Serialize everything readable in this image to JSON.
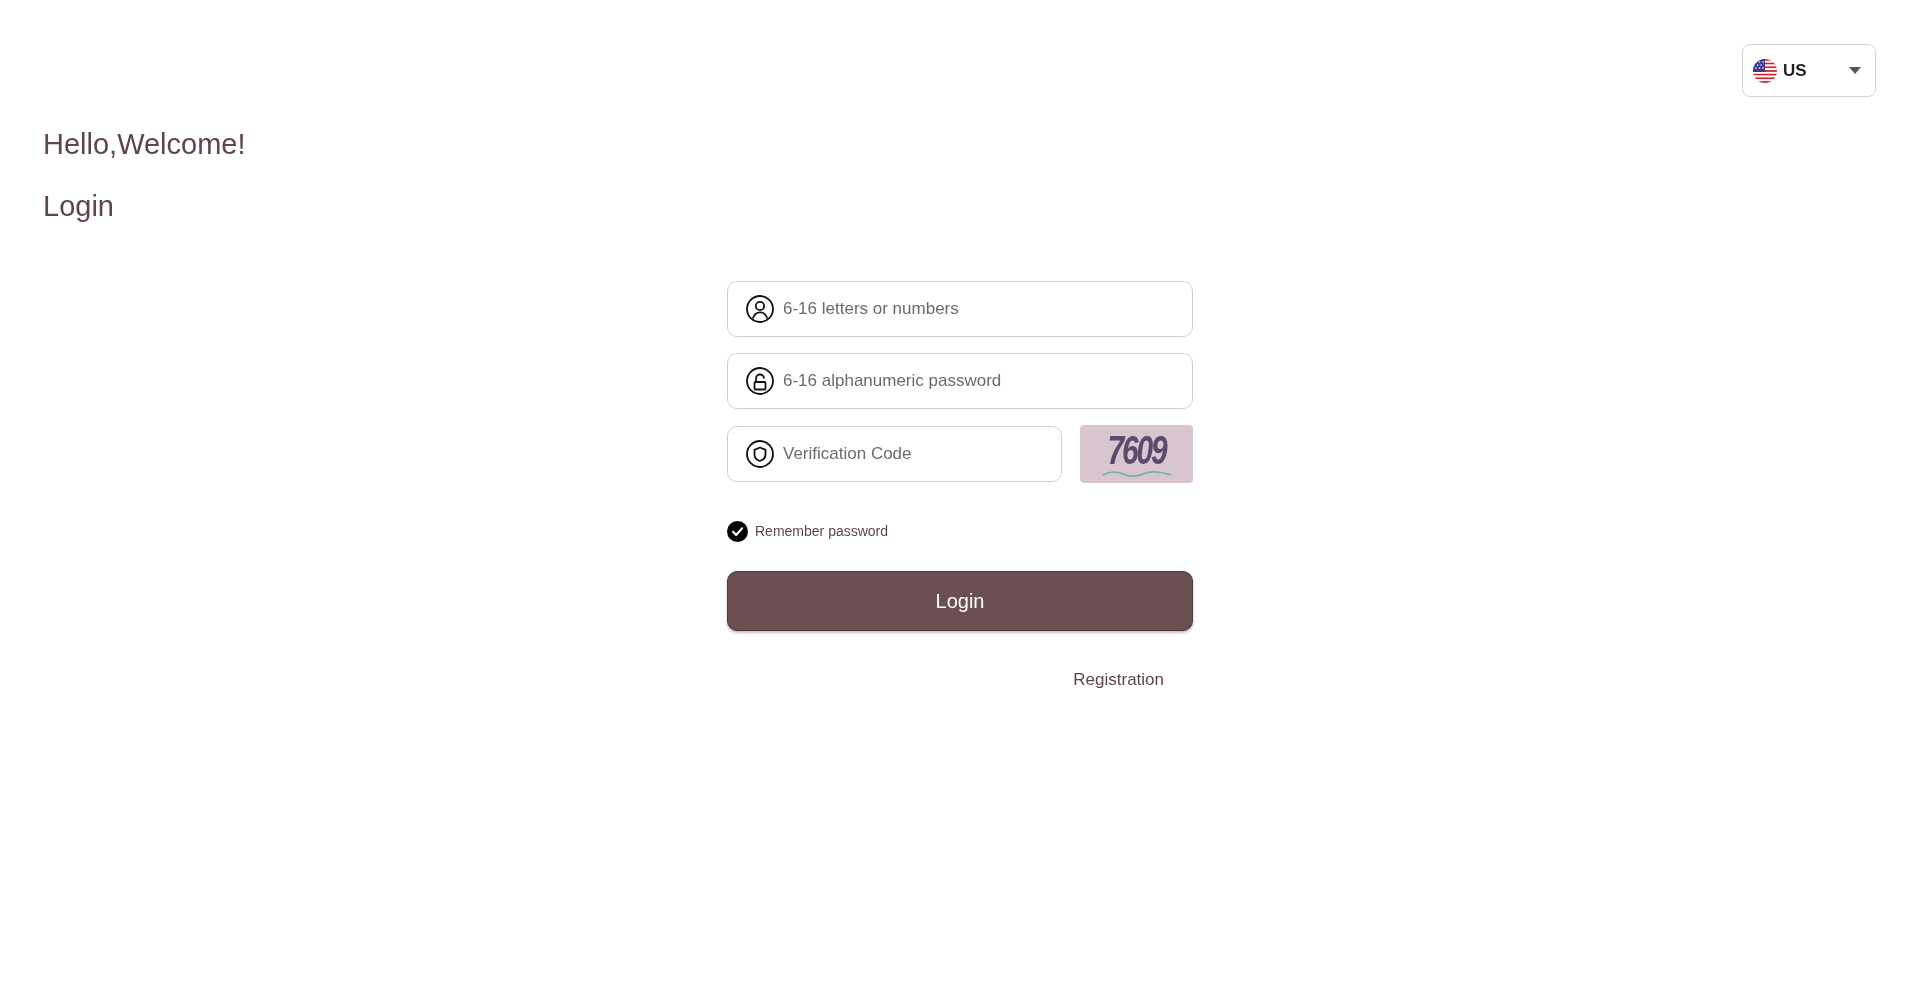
{
  "language_selector": {
    "label": "US"
  },
  "greeting": "Hello,Welcome!",
  "title": "Login",
  "form": {
    "username": {
      "placeholder": "6-16 letters or numbers"
    },
    "password": {
      "placeholder": "6-16 alphanumeric password"
    },
    "verification_code": {
      "placeholder": "Verification Code"
    },
    "captcha": {
      "code": "7609"
    },
    "remember_password": {
      "label": "Remember password",
      "checked": true
    },
    "login_button": "Login",
    "registration_link": "Registration"
  }
}
